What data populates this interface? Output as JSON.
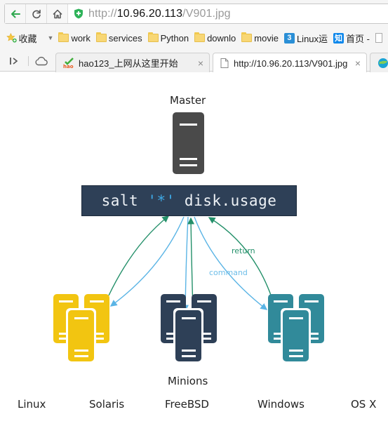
{
  "browser": {
    "address_bar": {
      "scheme": "http://",
      "host": "10.96.20.113",
      "path": "/V901.jpg"
    },
    "nav_buttons": [
      {
        "name": "back",
        "icon": "arrow-left-icon"
      },
      {
        "name": "reload",
        "icon": "reload-icon"
      },
      {
        "name": "home",
        "icon": "home-icon"
      }
    ],
    "bookmarks": {
      "favorites_label": "收藏",
      "items": [
        {
          "label": "work",
          "icon": "folder-icon"
        },
        {
          "label": "services",
          "icon": "folder-icon"
        },
        {
          "label": "Python",
          "icon": "folder-icon"
        },
        {
          "label": "downlo",
          "icon": "folder-icon"
        },
        {
          "label": "movie",
          "icon": "folder-icon"
        },
        {
          "label": "Linux运",
          "icon": "site-3-icon"
        },
        {
          "label": "首页 -",
          "icon": "zhihu-icon",
          "icon_text": "知"
        }
      ]
    },
    "tabs": [
      {
        "label": "hao123_上网从这里开始",
        "icon": "hao123-icon",
        "active": false
      },
      {
        "label": "http://10.96.20.113/V901.jpg",
        "icon": "page-icon",
        "active": true
      },
      {
        "label": "",
        "icon": "china-mobile-icon",
        "active": false
      }
    ],
    "colors": {
      "secure_green": "#2fb35a",
      "back_green": "#2fa84f"
    }
  },
  "diagram": {
    "master_label": "Master",
    "command": {
      "prefix": "salt ",
      "target": "'*'",
      "suffix": " disk.usage"
    },
    "annotations": {
      "return_label": "return",
      "command_label": "command"
    },
    "minions_label": "Minions",
    "os_labels": [
      "Linux",
      "Solaris",
      "FreeBSD",
      "Windows",
      "OS X"
    ],
    "colors": {
      "master": "#4a4a4a",
      "command_box": "#2e4057",
      "target_star": "#3ea9e6",
      "minion_group_1": "#f2c511",
      "minion_group_2": "#2e4057",
      "minion_group_3": "#318a9a",
      "command_arrow": "#5ab4e5",
      "return_arrow": "#24906a"
    }
  }
}
